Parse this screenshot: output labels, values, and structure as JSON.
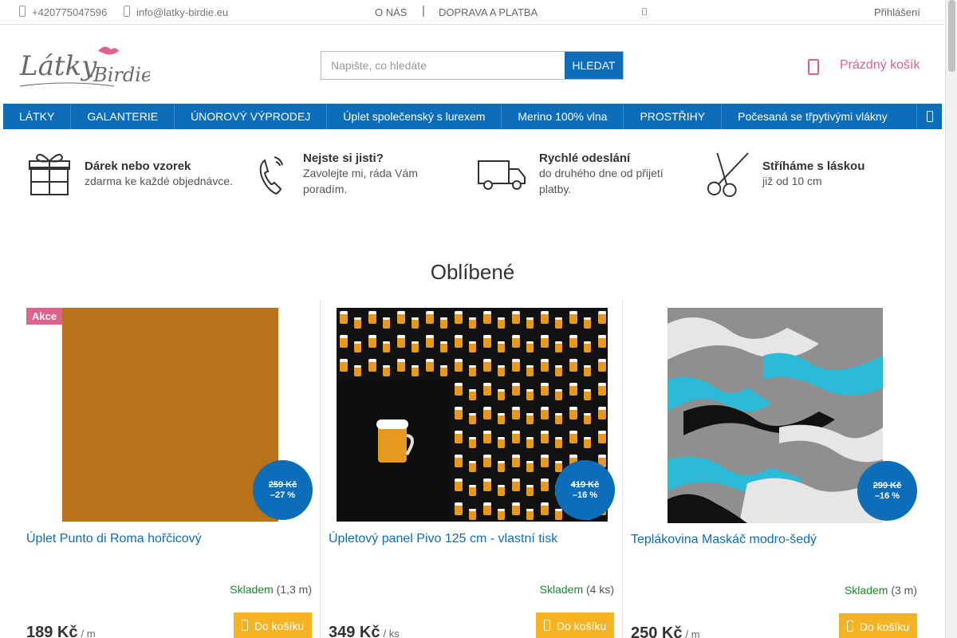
{
  "topbar": {
    "phone": "+420775047596",
    "email": "info@latky-birdie.eu",
    "nav": [
      "O NÁS",
      "DOPRAVA A PLATBA"
    ],
    "separator": "|",
    "login": "Přihlášení"
  },
  "header": {
    "logo_text": "Látky-Birdie",
    "search": {
      "placeholder": "Napište, co hledáte",
      "button": "HLEDAT"
    },
    "cart": {
      "label": "Prázdný košík"
    }
  },
  "mainnav": {
    "items": [
      "LÁTKY",
      "GALANTERIE",
      "ÚNOROVÝ VÝPRODEJ",
      "Úplet společenský s lurexem",
      "Merino 100% vlna",
      "PROSTŘIHY",
      "Počesaná se třpytivými vlákny"
    ]
  },
  "benefits": [
    {
      "icon": "gift-icon",
      "title": "Dárek nebo vzorek",
      "desc": "zdarma ke každé objednávce."
    },
    {
      "icon": "phone-icon",
      "title": "Nejste si jisti?",
      "desc": "Zavolejte mi, ráda Vám poradím."
    },
    {
      "icon": "truck-icon",
      "title": "Rychlé odeslání",
      "desc": "do druhého dne od přijetí platby."
    },
    {
      "icon": "scissors-icon",
      "title": "Stříháme s láskou",
      "desc": "již od 10 cm"
    }
  ],
  "section": {
    "title": "Oblíbené"
  },
  "products": [
    {
      "flag": "Akce",
      "name": "Úplet Punto di Roma hořčicový",
      "old_price": "259 Kč",
      "discount": "–27 %",
      "stock_label": "Skladem",
      "stock_qty": "(1,3 m)",
      "price": "189 Kč",
      "unit": "/ m",
      "buy": "Do košíku",
      "image_color": "#b8721a"
    },
    {
      "flag": "",
      "name": "Úpletový panel Pivo 125 cm - vlastní tisk",
      "old_price": "419 Kč",
      "discount": "–16 %",
      "stock_label": "Skladem",
      "stock_qty": "(4 ks)",
      "price": "349 Kč",
      "unit": "/ ks",
      "buy": "Do košíku",
      "image_color": "#111111"
    },
    {
      "flag": "",
      "name": "Teplákovina Maskáč modro-šedý",
      "old_price": "299 Kč",
      "discount": "–16 %",
      "stock_label": "Skladem",
      "stock_qty": "(3 m)",
      "price": "250 Kč",
      "unit": "/ m",
      "buy": "Do košíku",
      "image_color": "#9a9a9a"
    }
  ],
  "colors": {
    "accent": "#0e6db9",
    "brand_pink": "#e0628a",
    "buy": "#f5b323",
    "stock": "#1a8a2e"
  }
}
